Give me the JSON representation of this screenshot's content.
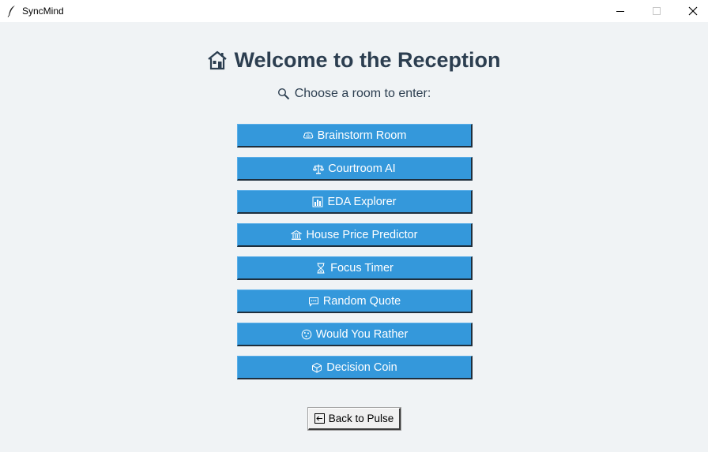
{
  "window": {
    "title": "SyncMind",
    "controls": {
      "minimize": "minimize-icon",
      "maximize": "maximize-icon",
      "close": "close-icon"
    }
  },
  "header": {
    "title": "Welcome to the Reception",
    "title_icon": "house-icon",
    "subtitle": "Choose a room to enter:",
    "subtitle_icon": "magnifier-icon"
  },
  "rooms": [
    {
      "label": "Brainstorm Room",
      "icon": "brain-icon"
    },
    {
      "label": "Courtroom AI",
      "icon": "scales-icon"
    },
    {
      "label": "EDA Explorer",
      "icon": "bar-chart-icon"
    },
    {
      "label": "House Price Predictor",
      "icon": "bank-icon"
    },
    {
      "label": "Focus Timer",
      "icon": "hourglass-icon"
    },
    {
      "label": "Random Quote",
      "icon": "speech-bubble-icon"
    },
    {
      "label": "Would You Rather",
      "icon": "game-die-icon"
    },
    {
      "label": "Decision Coin",
      "icon": "cube-icon"
    }
  ],
  "footer": {
    "back_label": "Back to Pulse",
    "back_icon": "left-arrow-icon"
  },
  "colors": {
    "background": "#f0f3f5",
    "heading_text": "#2c3e50",
    "room_button": "#3498db",
    "room_button_text": "#ffffff"
  }
}
